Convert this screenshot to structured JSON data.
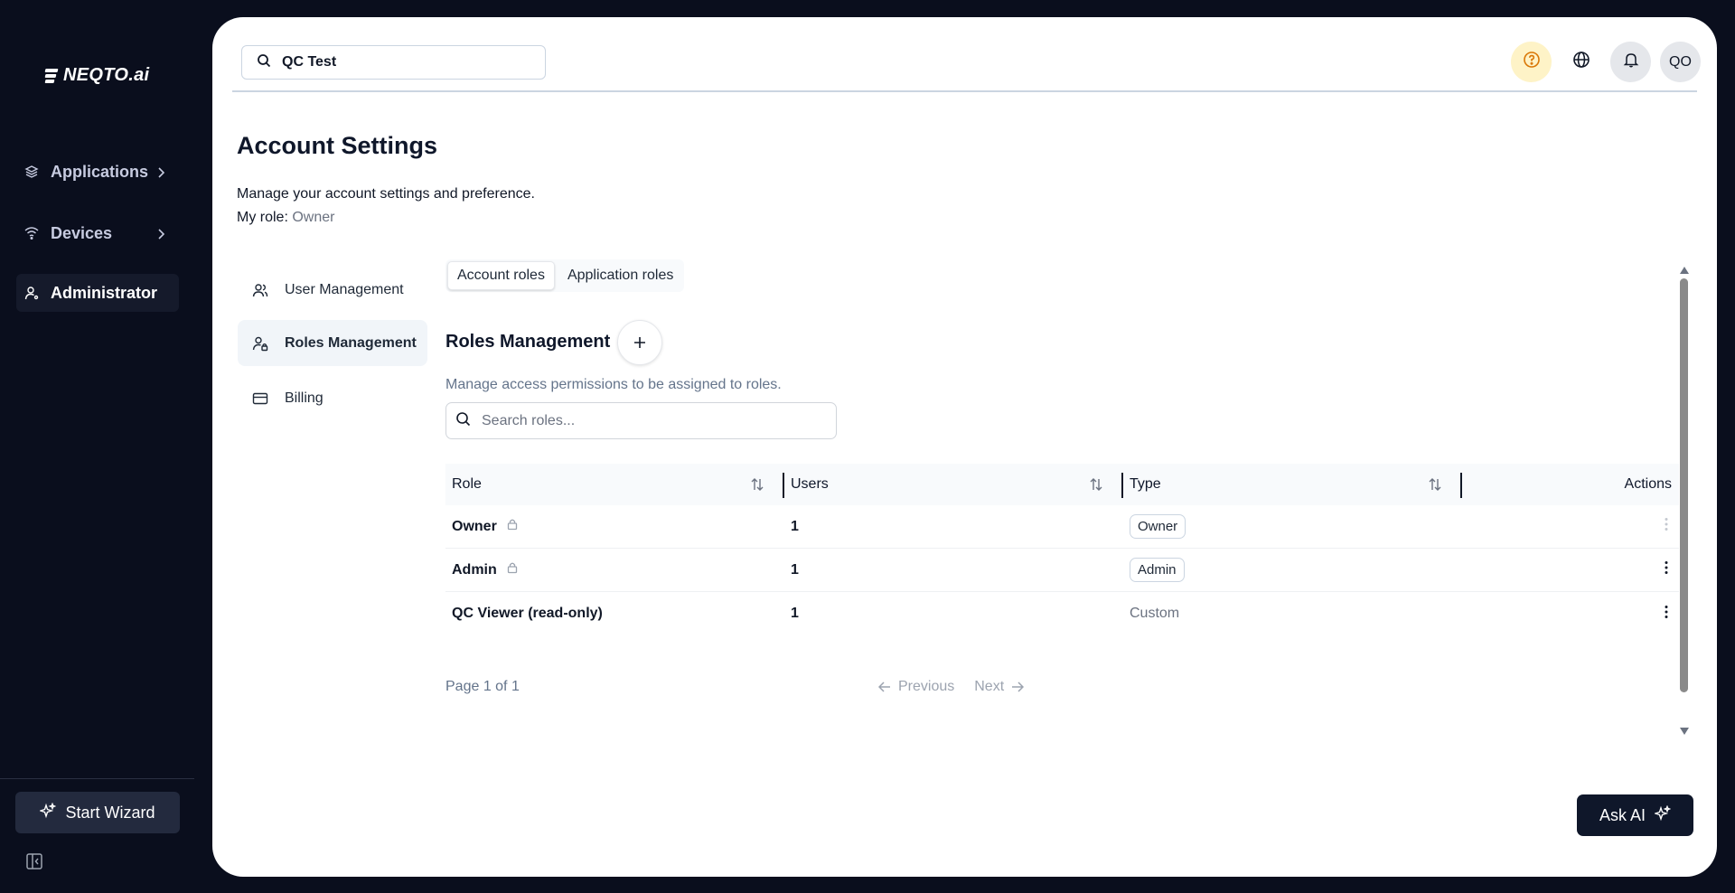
{
  "app": {
    "logo_text": "NEQTO.ai"
  },
  "sidebar": {
    "items": [
      {
        "label": "Applications",
        "icon": "layers-icon"
      },
      {
        "label": "Devices",
        "icon": "wifi-icon"
      },
      {
        "label": "Administrator",
        "icon": "user-icon"
      }
    ],
    "start_wizard_label": "Start Wizard"
  },
  "topbar": {
    "search_value": "QC Test",
    "avatar_initials": "QO"
  },
  "page": {
    "title": "Account Settings",
    "subtitle": "Manage your account settings and preference.",
    "my_role_label": "My role:",
    "my_role_value": "Owner"
  },
  "settings_nav": {
    "items": [
      {
        "label": "User Management",
        "icon": "users-icon"
      },
      {
        "label": "Roles Management",
        "icon": "user-lock-icon"
      },
      {
        "label": "Billing",
        "icon": "credit-card-icon"
      }
    ]
  },
  "tabs": [
    {
      "label": "Account roles"
    },
    {
      "label": "Application roles"
    }
  ],
  "roles": {
    "title": "Roles Management",
    "add_label": "+",
    "description": "Manage access permissions to be assigned to roles.",
    "search_placeholder": "Search roles...",
    "columns": [
      "Role",
      "Users",
      "Type",
      "Actions"
    ],
    "rows": [
      {
        "role": "Owner",
        "locked": true,
        "users": "1",
        "type": "Owner",
        "type_style": "badge"
      },
      {
        "role": "Admin",
        "locked": true,
        "users": "1",
        "type": "Admin",
        "type_style": "badge"
      },
      {
        "role": "QC Viewer (read-only)",
        "locked": false,
        "users": "1",
        "type": "Custom",
        "type_style": "text"
      }
    ],
    "page_info": "Page 1 of 1",
    "previous_label": "Previous",
    "next_label": "Next"
  },
  "ask_ai_label": "Ask AI",
  "colors": {
    "sidebar_bg": "#0a0e1d",
    "primary_dark": "#0f172a",
    "help_bg": "#fef3c7",
    "help_icon": "#d97706"
  }
}
